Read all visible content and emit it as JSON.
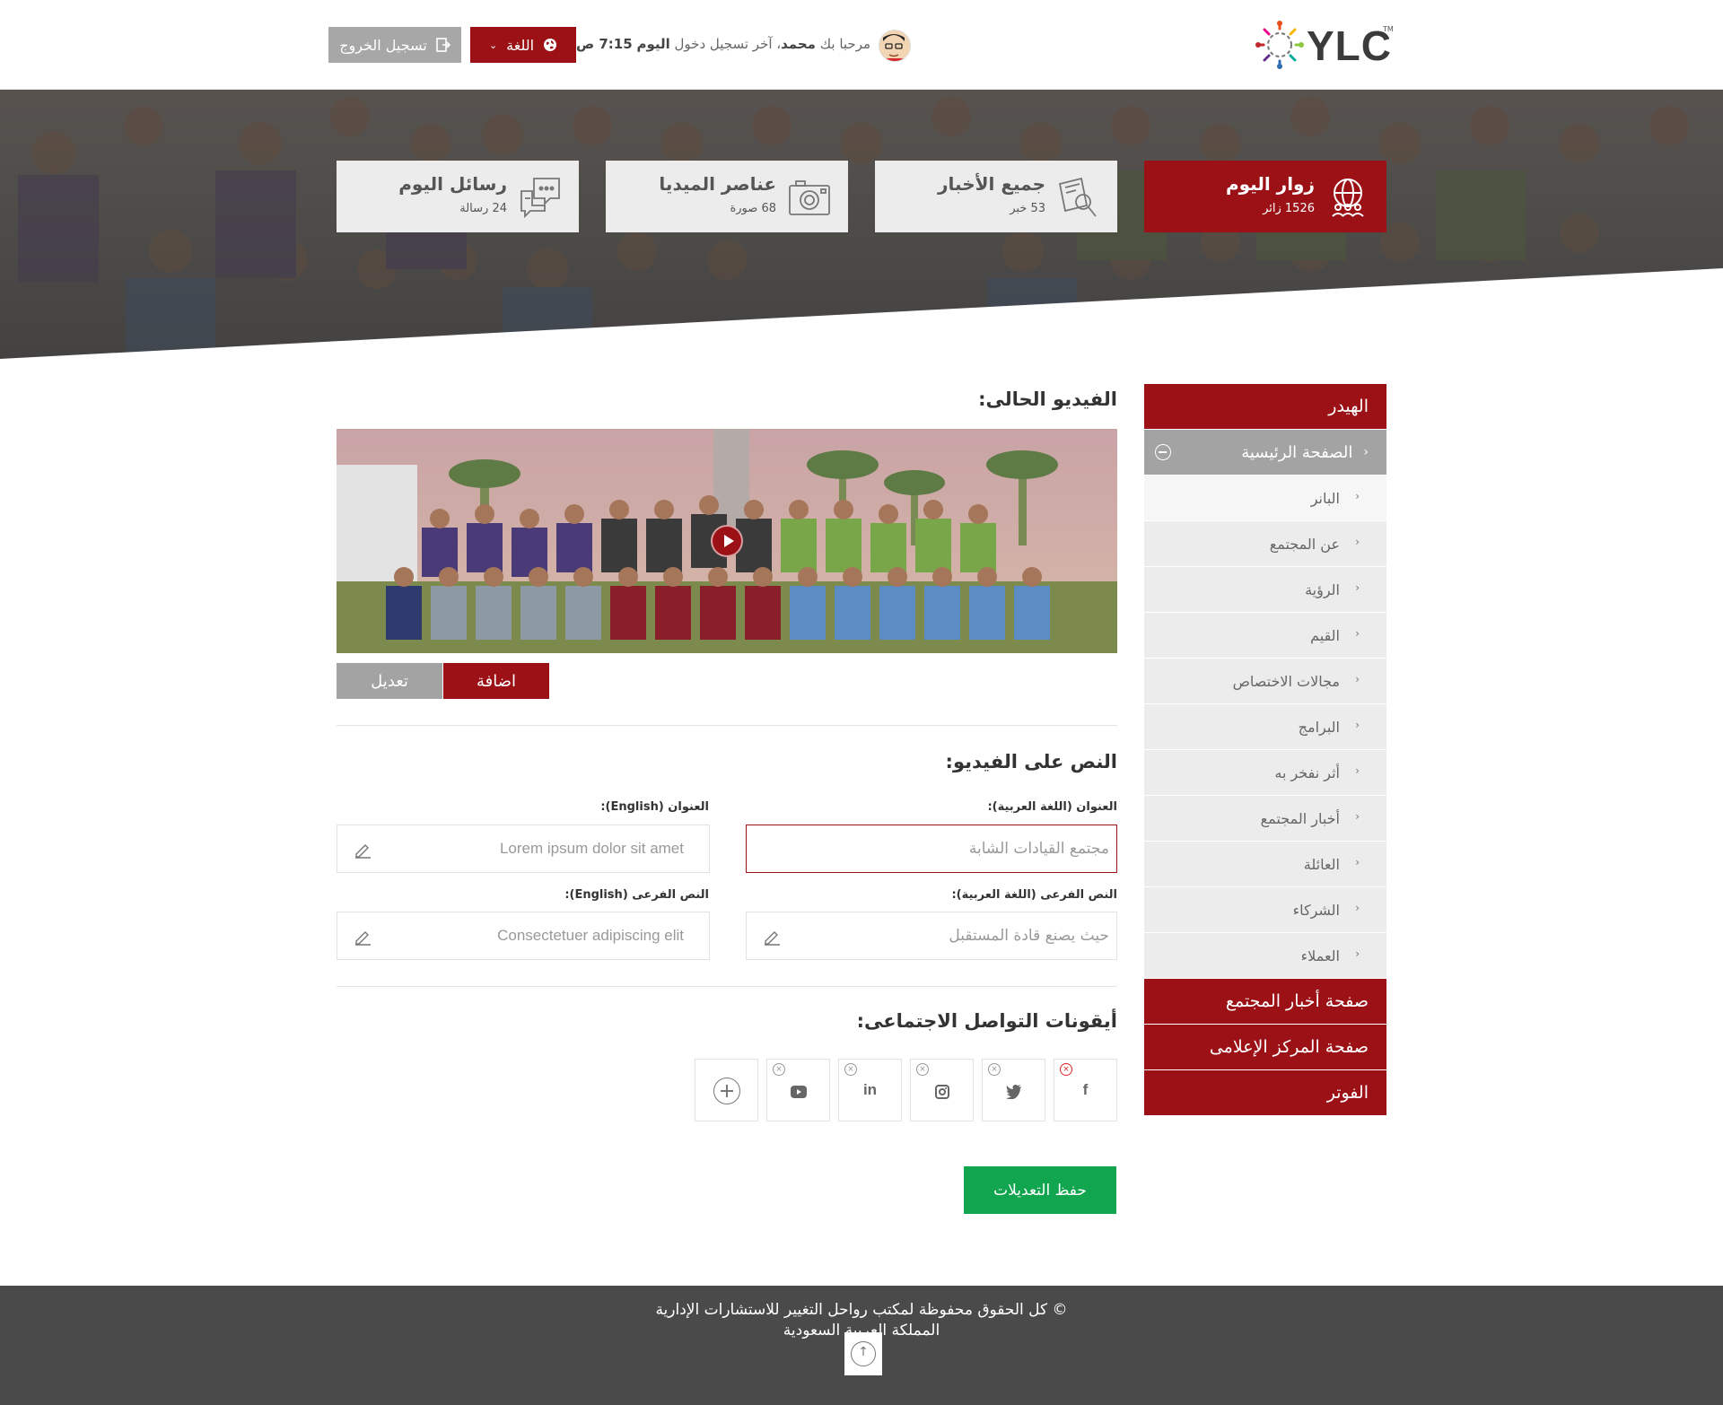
{
  "header": {
    "logo_text": "YLC",
    "logo_tm": "TM",
    "welcome_prefix": "مرحبا بك",
    "user_name": "محمد",
    "last_login_prefix": "، آخر تسجيل دخول",
    "last_login_day": "اليوم",
    "last_login_time": "7:15 ص",
    "language_label": "اللغة",
    "logout_label": "تسجيل الخروج"
  },
  "stats": [
    {
      "title": "زوار اليوم",
      "sub": "1526 زائر",
      "icon": "globe-people-icon"
    },
    {
      "title": "جميع الأخبار",
      "sub": "53 خبر",
      "icon": "news-search-icon"
    },
    {
      "title": "عناصر الميديا",
      "sub": "68 صورة",
      "icon": "camera-icon"
    },
    {
      "title": "رسائل اليوم",
      "sub": "24 رسالة",
      "icon": "chat-bubble-icon"
    }
  ],
  "sidebar": {
    "header": "الهيدر",
    "home": "الصفحة الرئيسية",
    "items": [
      "البانر",
      "عن المجتمع",
      "الرؤية",
      "القيم",
      "مجالات الاختصاص",
      "البرامج",
      "أثر نفخر به",
      "أخبار المجتمع",
      "العائلة",
      "الشركاء",
      "العملاء"
    ],
    "news_page": "صفحة أخبار المجتمع",
    "media_page": "صفحة المركز الإعلامى",
    "footer": "الفوتر"
  },
  "main": {
    "current_video_title": "الفيديو الحالى:",
    "add_label": "اضافة",
    "edit_label": "تعديل",
    "video_text_title": "النص على الفيديو:",
    "title_ar_label": "العنوان (اللغة العربية):",
    "title_ar_value": "مجتمع القيادات الشابة",
    "title_en_label": "العنوان (English):",
    "title_en_value": "Lorem ipsum dolor sit amet",
    "sub_ar_label": "النص الفرعى (اللغة العربية):",
    "sub_ar_value": "حيث يصنع قادة المستقبل",
    "sub_en_label": "النص الفرعى (English):",
    "sub_en_value": "Consectetuer adipiscing elit",
    "social_title": "أيقونات التواصل الاجتماعى:",
    "social_icons": [
      {
        "name": "facebook-icon",
        "glyph": "f"
      },
      {
        "name": "twitter-icon",
        "glyph": "🐦"
      },
      {
        "name": "instagram-icon",
        "glyph": "◙"
      },
      {
        "name": "linkedin-icon",
        "glyph": "in"
      },
      {
        "name": "youtube-icon",
        "glyph": "▶"
      }
    ],
    "save_label": "حفظ التعديلات"
  },
  "footer": {
    "line1": "© كل الحقوق محفوظة لمكتب رواحل التغيير للاستشارات الإدارية",
    "line2": "المملكة العربية السعودية"
  },
  "colors": {
    "brand_red": "#9b1116",
    "gray_button": "#a3a3a3",
    "save_green": "#12a54f",
    "footer_bg": "#4a4a4a"
  }
}
